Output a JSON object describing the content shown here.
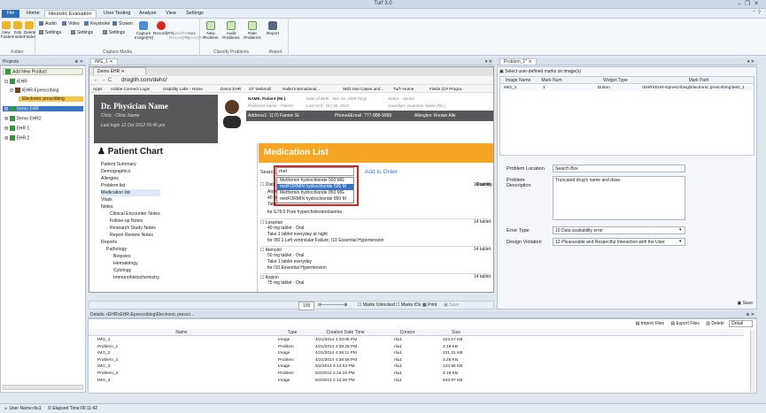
{
  "window": {
    "title": "Turf 3.0"
  },
  "menu": {
    "file": "File",
    "tabs": [
      "Home",
      "Heuristic Evaluation",
      "User Testing",
      "Analyze",
      "View",
      "Settings"
    ],
    "active_tab": "Heuristic Evaluation"
  },
  "ribbon": {
    "folder_group": {
      "label": "Folder",
      "buttons": [
        "New Folder",
        "Edit Folder",
        "Delete Folder"
      ]
    },
    "capture_group": {
      "label": "Capture Media",
      "checks": [
        "Audio",
        "Video",
        "Keystroke",
        "Screen"
      ],
      "settings": [
        "Settings",
        "Settings",
        "Settings"
      ],
      "buttons": [
        "Capture Image(F5)",
        "Record(F7)",
        "Pause/Restart Record(F8)",
        "Stop Record(F9)"
      ]
    },
    "classify_group": {
      "label": "Classify Problems",
      "buttons": [
        "New Problem",
        "Audit Problems",
        "Rate Problems",
        "Report"
      ]
    },
    "report_group": {
      "label": "Report"
    }
  },
  "projects": {
    "header": "Projects",
    "add": "Add New Product",
    "tree": [
      "rEHR",
      "rEHR-Eprescribing",
      "Electronic prescribing",
      "Demo EHR",
      "Demo EHR2",
      "EHR 1",
      "EHR 2"
    ]
  },
  "doc_tab": "IMG_1",
  "browser": {
    "tab": "Demo EHR",
    "url": "drogith.com/dehc/",
    "bookmarks": [
      "Apps",
      "Adobe Connect Login",
      "Usability Labs - Home",
      "Demo EHR",
      "UT Webmail",
      "Hatlel International...",
      "SED Use Cases and...",
      "Turf--Home",
      "Fields (C# Progra"
    ]
  },
  "ehr": {
    "doctor": "Dr. Physician Name",
    "clinic": "Clinic : Clinic Name",
    "last_login": "Last login 12 Oct 2012 05:45 pm",
    "patient_name_label": "NAME, Patient (Mr.)",
    "pref_name": "Preferred Name : Patient",
    "dob": "Date of Birth : Mar 15, 1969 (52y)",
    "last_visit": "Last visit : Oct 30, 2012",
    "status": "Status : Senior",
    "guardian": "Guardian: Guardian Name (Mr.)",
    "address": "Address1: 1170  Fannin  St.",
    "phone": "Phone&Email: 777-888-9999",
    "allergies": "Allergies: Known  Alle"
  },
  "chart": {
    "title": "Patient Chart",
    "items": [
      "Patient Summary",
      "Demographics",
      "Allergies",
      "Problem list",
      "Medication list",
      "Vitals",
      "Notes",
      "Clinical Encounter Notes",
      "Follow-up Notes",
      "Research Study Notes",
      "Report Review Notes",
      "Reports",
      "Pathology",
      "Biopsies",
      "Hematology",
      "Cytology",
      "Immunohistochemistry"
    ]
  },
  "medication": {
    "title": "Medication List",
    "search_label": "Search",
    "search_value": "met",
    "add_label": "Add to Order",
    "quantity_header": "Quantity",
    "dropdown": [
      "Metformin hydrochloride 500 MG",
      "metFORMIN hydrochloride 500 M",
      "Metformin hydrochloride 850 MG",
      "metFORMIN hydrochloride 850 M"
    ],
    "entries": [
      {
        "name": "Diab",
        "lines": [
          "Atorv",
          "40 m",
          "Take",
          "for E78.0 Pure hypercholesterolaemia"
        ],
        "qty": "14 tablet"
      },
      {
        "name": "Losartan",
        "lines": [
          "40 mg tablet - Oral",
          "Take 1 tablet everyday at night",
          "for I50.1 Left ventricular Failure, I10 Essential Hypertension"
        ],
        "qty": "14 tablet"
      },
      {
        "name": "Atenolol",
        "lines": [
          "50 mg tablet - Oral",
          "Take 1 tablet everyday",
          "for I10 Essential Hypertension"
        ],
        "qty": "14 tablet"
      },
      {
        "name": "Aspirin",
        "lines": [
          "75 mg tablet - Oral"
        ],
        "qty": "14 tablet"
      }
    ]
  },
  "viewer_toolbar": {
    "zoom": "100",
    "marks_unlocked": "Marks Unlocked",
    "marks_ids": "Marks IDs",
    "print": "Print",
    "save": "Save"
  },
  "problem": {
    "tab": "Problem_1*",
    "select_marks": "Select user-defined marks on image(s)",
    "columns": [
      "Image Name",
      "Mark Num",
      "Widget Type",
      "Mark Path"
    ],
    "row": [
      "IMG_1",
      "1",
      "Button",
      "rEHR\\rEHR-Eprescribing\\Electronic prescribing\\IMG_1"
    ],
    "location_label": "Problem Location",
    "location_value": "Search Box",
    "description_label": "Problem Description",
    "description_value": "Truncated drug's name and dose.",
    "error_type_label": "Error Type",
    "error_type_value": "10 Data availability error",
    "violation_label": "Design Violation",
    "violation_value": "12-Pleasurable and Respectful Interaction with the User",
    "save": "Save"
  },
  "details": {
    "header": "Details: rEHR\\rEHR-Eprescribing\\Electronic prescri...",
    "import": "Import Files",
    "export": "Export Files",
    "delete": "Delete",
    "view": "Detail",
    "columns": [
      "Name",
      "Type",
      "Creation Date Time",
      "Creator",
      "Size"
    ],
    "rows": [
      [
        "IMG_1",
        "Image",
        "4/21/2014 4:20:05 PM",
        "rliu1",
        "223.57 KB"
      ],
      [
        "Problem_1",
        "Problem",
        "4/21/2014 4:38:26 PM",
        "rliu1",
        "3.19 KB"
      ],
      [
        "IMG_2",
        "Image",
        "4/21/2014 4:36:11 PM",
        "rliu1",
        "231.21 KB"
      ],
      [
        "Problem_2",
        "Problem",
        "4/21/2014 4:38:58 PM",
        "rliu1",
        "3.25 KB"
      ],
      [
        "IMG_3",
        "Image",
        "5/2/2014 4:14:03 PM",
        "rliu1",
        "123.95 KB"
      ],
      [
        "Problem_3",
        "Problem",
        "5/2/2014 4:16:15 PM",
        "rliu1",
        "3.19 KB"
      ],
      [
        "IMG_4",
        "Image",
        "5/2/2014 4:14:36 PM",
        "rliu1",
        "943.87 KB"
      ]
    ]
  },
  "status": {
    "user": "User Name:rliu1",
    "elapsed": "Elapsed Time:00:11:42"
  },
  "colors": {
    "accent": "#2e6db4",
    "orange": "#f5a623",
    "header_gray": "#58585b",
    "red": "#d9241e"
  }
}
